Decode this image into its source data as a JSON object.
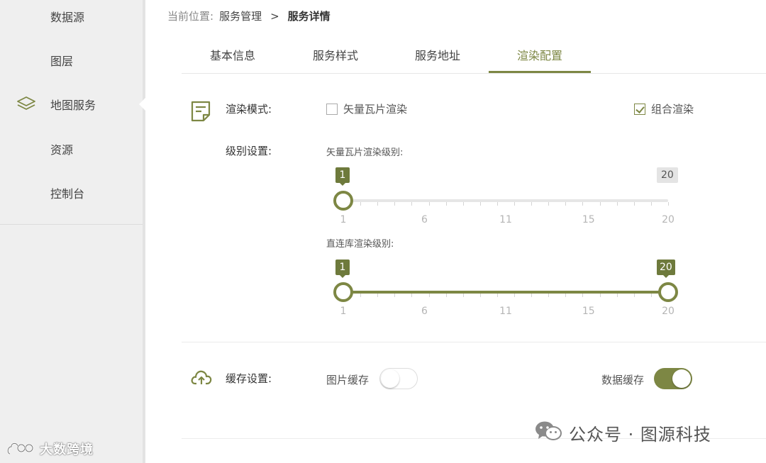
{
  "sidebar": {
    "items": [
      {
        "label": "数据源"
      },
      {
        "label": "图层"
      },
      {
        "label": "地图服务"
      },
      {
        "label": "资源"
      },
      {
        "label": "控制台"
      }
    ]
  },
  "breadcrumb": {
    "prefix": "当前位置:",
    "parent": "服务管理",
    "separator": ">",
    "current": "服务详情"
  },
  "tabs": [
    {
      "label": "基本信息",
      "active": false
    },
    {
      "label": "服务样式",
      "active": false
    },
    {
      "label": "服务地址",
      "active": false
    },
    {
      "label": "渲染配置",
      "active": true
    }
  ],
  "render_mode": {
    "label": "渲染模式:",
    "options": [
      {
        "label": "矢量瓦片渲染",
        "checked": false
      },
      {
        "label": "组合渲染",
        "checked": true
      }
    ]
  },
  "level_settings": {
    "label": "级别设置:",
    "sliders": [
      {
        "title": "矢量瓦片渲染级别:",
        "min": 1,
        "max": 20,
        "low": 1,
        "high": 20,
        "range_filled": false,
        "low_bubble": "1",
        "high_bubble": "20",
        "ticks": [
          "1",
          "6",
          "11",
          "15",
          "20"
        ]
      },
      {
        "title": "直连库渲染级别:",
        "min": 1,
        "max": 20,
        "low": 1,
        "high": 20,
        "range_filled": true,
        "low_bubble": "1",
        "high_bubble": "20",
        "ticks": [
          "1",
          "6",
          "11",
          "15",
          "20"
        ]
      }
    ]
  },
  "cache": {
    "label": "缓存设置:",
    "image_cache": {
      "label": "图片缓存",
      "on": false
    },
    "data_cache": {
      "label": "数据缓存",
      "on": true
    }
  },
  "brand": {
    "text": "大数跨境"
  },
  "watermark": {
    "text": "公众号 · 图源科技"
  },
  "colors": {
    "accent": "#7d8744",
    "bubble": "#6e7a3c",
    "sidebar_bg": "#efefef"
  }
}
